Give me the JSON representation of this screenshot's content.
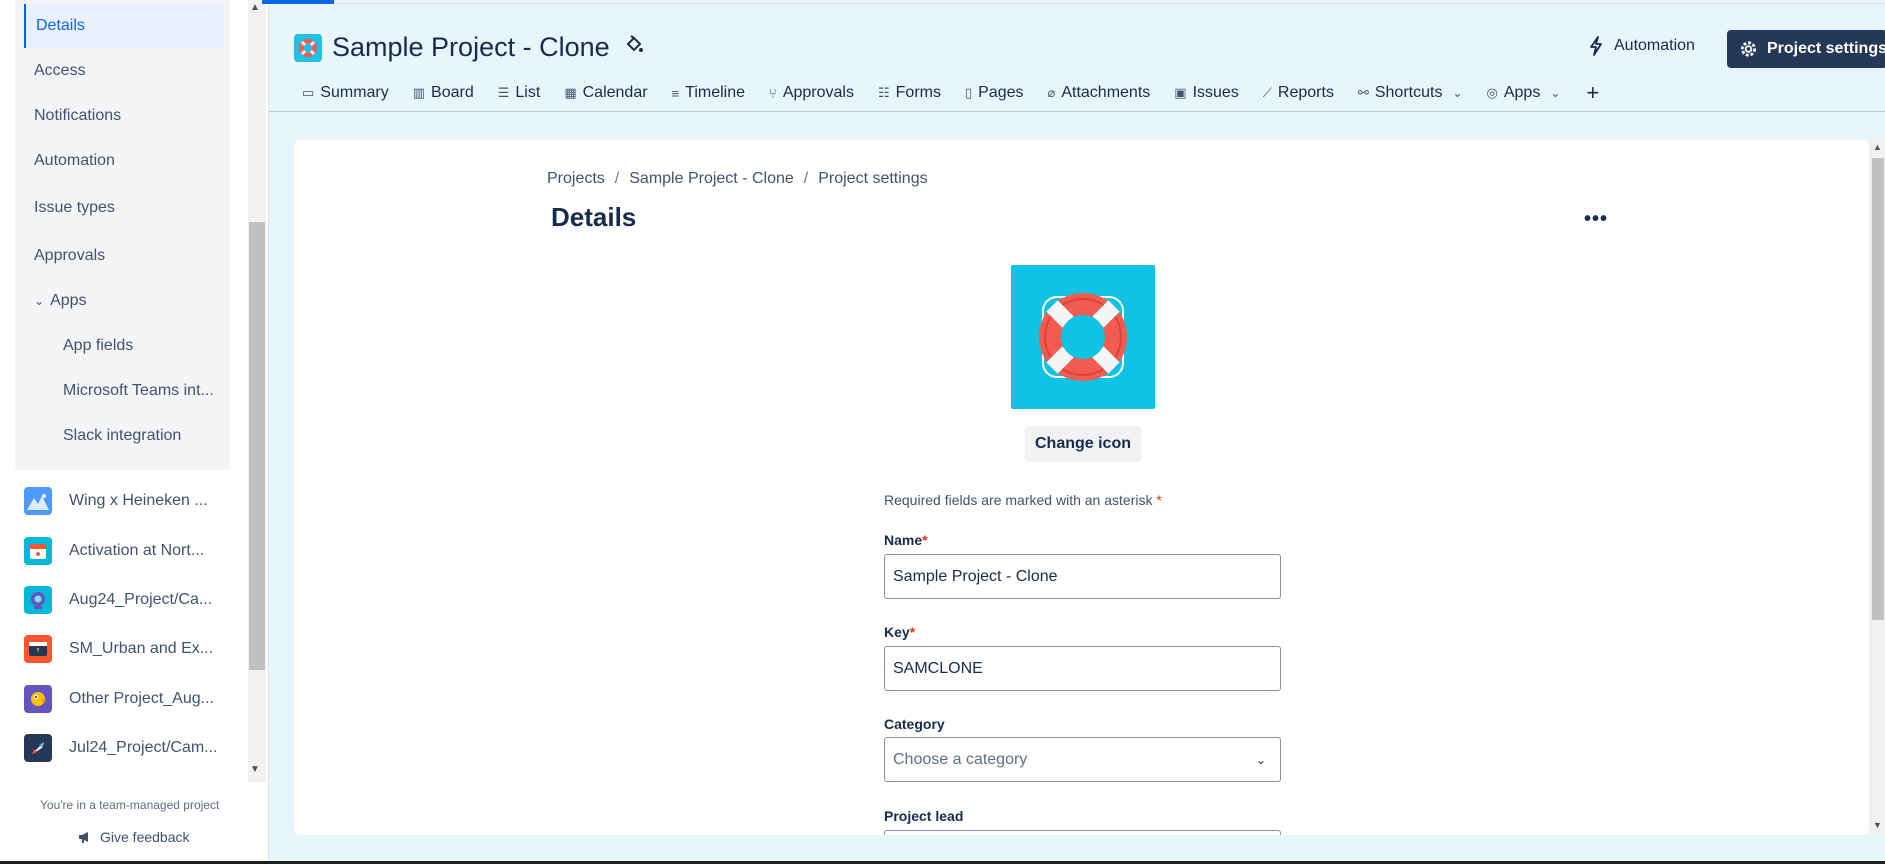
{
  "sidebar": {
    "settings_items": [
      {
        "label": "Details"
      },
      {
        "label": "Access"
      },
      {
        "label": "Notifications"
      },
      {
        "label": "Automation"
      },
      {
        "label": "Issue types"
      },
      {
        "label": "Approvals"
      },
      {
        "label": "Apps"
      },
      {
        "label": "App fields"
      },
      {
        "label": "Microsoft Teams int..."
      },
      {
        "label": "Slack integration"
      }
    ],
    "projects": [
      {
        "name": "Wing x Heineken ...",
        "icon": "mountain-icon",
        "color": "#4c9aff"
      },
      {
        "name": "Activation at Nort...",
        "icon": "calendar-icon",
        "color": "#00b8d9"
      },
      {
        "name": "Aug24_Project/Ca...",
        "icon": "robot-icon",
        "color": "#00b8d9"
      },
      {
        "name": "SM_Urban and Ex...",
        "icon": "film-icon",
        "color": "#ff5630"
      },
      {
        "name": "Other Project_Aug...",
        "icon": "bird-icon",
        "color": "#6554c0"
      },
      {
        "name": "Jul24_Project/Cam...",
        "icon": "rocket-icon",
        "color": "#253858"
      }
    ],
    "team_note": "You're in a team-managed project",
    "feedback_label": "Give feedback"
  },
  "header": {
    "project_title": "Sample Project - Clone",
    "automation_label": "Automation",
    "settings_label": "Project settings"
  },
  "tabs": [
    {
      "label": "Summary",
      "icon": "summary-icon",
      "glyph": "▭"
    },
    {
      "label": "Board",
      "icon": "board-icon",
      "glyph": "▥"
    },
    {
      "label": "List",
      "icon": "list-icon",
      "glyph": "☰"
    },
    {
      "label": "Calendar",
      "icon": "calendar-icon",
      "glyph": "▦"
    },
    {
      "label": "Timeline",
      "icon": "timeline-icon",
      "glyph": "≡"
    },
    {
      "label": "Approvals",
      "icon": "approvals-icon",
      "glyph": "⑂"
    },
    {
      "label": "Forms",
      "icon": "forms-icon",
      "glyph": "☷"
    },
    {
      "label": "Pages",
      "icon": "pages-icon",
      "glyph": "▯"
    },
    {
      "label": "Attachments",
      "icon": "attachment-icon",
      "glyph": "⌀"
    },
    {
      "label": "Issues",
      "icon": "issues-icon",
      "glyph": "▣"
    },
    {
      "label": "Reports",
      "icon": "reports-icon",
      "glyph": "⟋"
    },
    {
      "label": "Shortcuts",
      "icon": "link-icon",
      "glyph": "⚯"
    },
    {
      "label": "Apps",
      "icon": "apps-icon",
      "glyph": "◎"
    }
  ],
  "breadcrumb": {
    "items": [
      "Projects",
      "Sample Project - Clone",
      "Project settings"
    ],
    "separator": "/"
  },
  "details": {
    "title": "Details",
    "change_icon_label": "Change icon",
    "required_note": "Required fields are marked with an asterisk",
    "asterisk": "*",
    "name_label": "Name",
    "name_value": "Sample Project - Clone",
    "key_label": "Key",
    "key_value": "SAMCLONE",
    "category_label": "Category",
    "category_placeholder": "Choose a category",
    "lead_label": "Project lead"
  },
  "colors": {
    "accent": "#0c66e4",
    "settings_button": "#253858",
    "project_icon_bg": "#0ec3e3",
    "lifebuoy_red": "#f15b50"
  }
}
